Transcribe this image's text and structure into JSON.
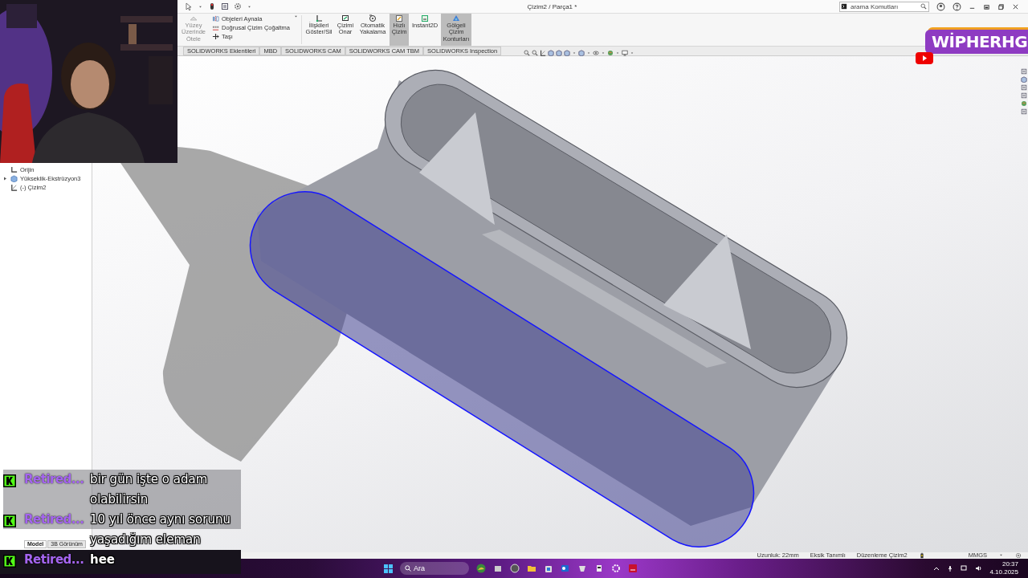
{
  "window": {
    "title": "Çizim2 / Parça1 *",
    "search": {
      "placeholder": "arama Komutları"
    }
  },
  "ribbon": {
    "disabled_tool": {
      "label": "Yüzey Üzerinde Ötele",
      "disabled": true
    },
    "list_tools": [
      {
        "label": "Objeleri Aynala"
      },
      {
        "label": "Doğrusal Çizim Çoğaltma"
      },
      {
        "label": "Taşı"
      }
    ],
    "large_tools": [
      {
        "label": "İlişkileri Göster/Sil",
        "selected": false
      },
      {
        "label": "Çizimi Onar",
        "selected": false
      },
      {
        "label": "Otomatik Yakalama",
        "selected": false
      },
      {
        "label": "Hızlı Çizim",
        "selected": true
      },
      {
        "label": "Instant2D",
        "selected": false
      },
      {
        "label": "Gölgeli Çizim Konturları",
        "selected": true
      }
    ]
  },
  "command_tabs": [
    {
      "label": "SOLIDWORKS Eklentileri",
      "selected": false
    },
    {
      "label": "MBD",
      "selected": false
    },
    {
      "label": "SOLIDWORKS CAM",
      "selected": false
    },
    {
      "label": "SOLIDWORKS CAM TBM",
      "selected": false
    },
    {
      "label": "SOLIDWORKS Inspection",
      "selected": false
    }
  ],
  "feature_tree": [
    {
      "kind": "origin",
      "label": "Orijin"
    },
    {
      "kind": "feature",
      "label": "Yükseklik-Ekstrüzyon3"
    },
    {
      "kind": "sketch",
      "label": "(-) Çizim2"
    }
  ],
  "model_tabs": [
    {
      "label": "Model",
      "selected": true
    },
    {
      "label": "3B Görünüm",
      "selected": false
    }
  ],
  "status_bar": {
    "items": [
      "Uzunluk: 22mm",
      "Eksik Tanımlı",
      "Düzenleme Çizim2"
    ],
    "units": "MMGS"
  },
  "taskbar": {
    "search": {
      "placeholder": "Ara"
    },
    "time": "20:37",
    "date": "4.10.2025"
  },
  "stream_overlay": {
    "channel": "WİPHERHG",
    "chat": [
      {
        "user": "Retired...",
        "message": "bir gün işte o adam olabilirsin"
      },
      {
        "user": "Retired...",
        "message": "10 yıl önce aynı sorunu yaşadığım eleman"
      },
      {
        "user": "Retired...",
        "message": "hee"
      }
    ]
  }
}
